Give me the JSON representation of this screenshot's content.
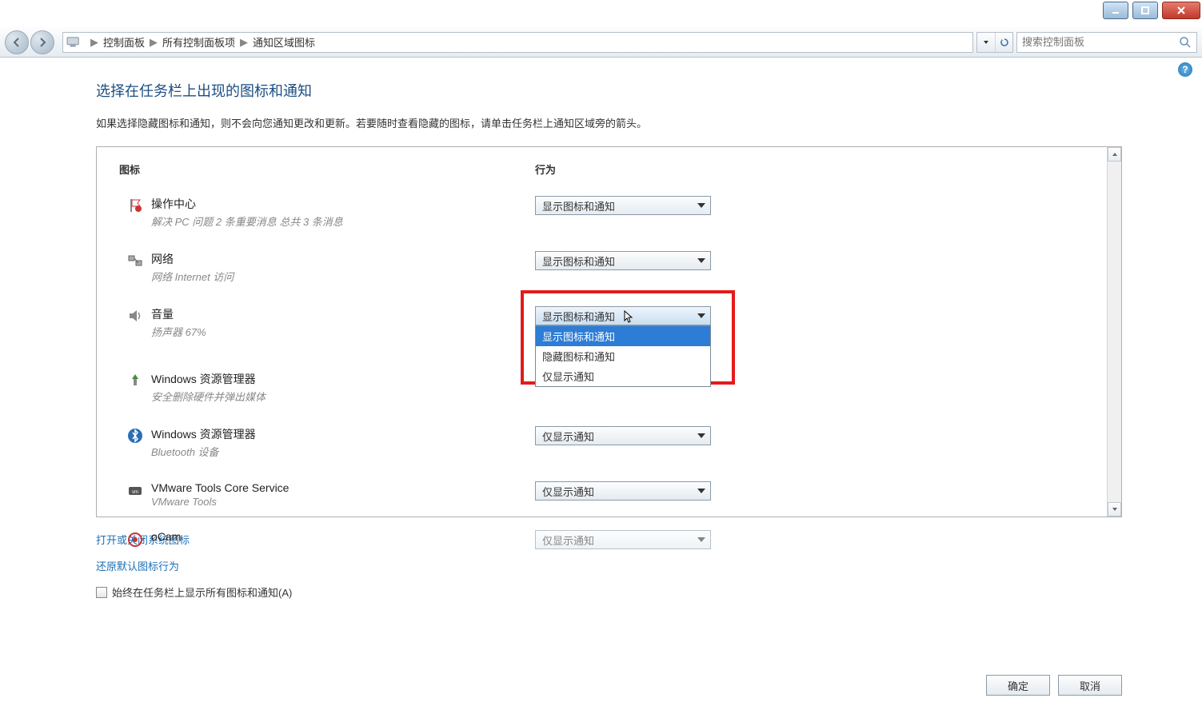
{
  "window": {
    "breadcrumb": [
      "控制面板",
      "所有控制面板项",
      "通知区域图标"
    ],
    "search_placeholder": "搜索控制面板"
  },
  "page": {
    "title": "选择在任务栏上出现的图标和通知",
    "description": "如果选择隐藏图标和通知，则不会向您通知更改和更新。若要随时查看隐藏的图标，请单击任务栏上通知区域旁的箭头。"
  },
  "table": {
    "col_icon": "图标",
    "col_behavior": "行为",
    "rows": [
      {
        "name": "操作中心",
        "sub": "解决 PC 问题  2 条重要消息  总共 3 条消息",
        "value": "显示图标和通知",
        "icon": "flag"
      },
      {
        "name": "网络",
        "sub": "网络 Internet 访问",
        "value": "显示图标和通知",
        "icon": "network"
      },
      {
        "name": "音量",
        "sub": "扬声器 67%",
        "value": "显示图标和通知",
        "icon": "speaker",
        "open": true
      },
      {
        "name": "Windows 资源管理器",
        "sub": "安全删除硬件并弹出媒体",
        "value": "",
        "icon": "usb"
      },
      {
        "name": "Windows 资源管理器",
        "sub": "Bluetooth 设备",
        "value": "仅显示通知",
        "icon": "bluetooth"
      },
      {
        "name": "VMware Tools Core Service",
        "sub": "VMware Tools",
        "value": "仅显示通知",
        "icon": "vmware"
      },
      {
        "name": "oCam",
        "sub": "",
        "value": "仅显示通知",
        "icon": "ocam"
      }
    ],
    "dropdown_options": [
      "显示图标和通知",
      "隐藏图标和通知",
      "仅显示通知"
    ]
  },
  "links": {
    "system_icons": "打开或关闭系统图标",
    "restore_default": "还原默认图标行为"
  },
  "checkbox": {
    "label": "始终在任务栏上显示所有图标和通知(A)"
  },
  "buttons": {
    "ok": "确定",
    "cancel": "取消"
  }
}
